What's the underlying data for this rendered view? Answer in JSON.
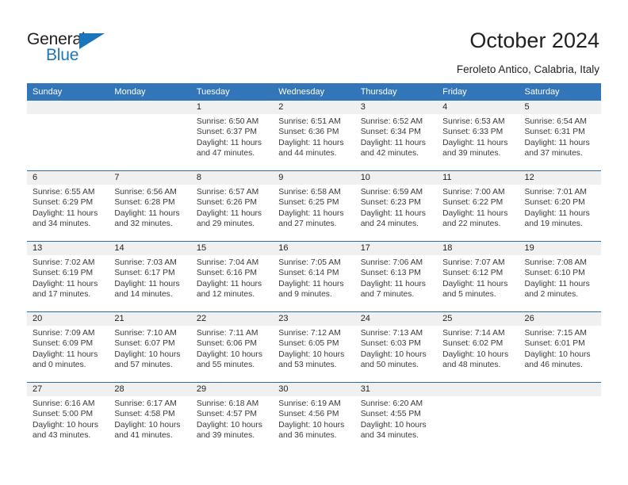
{
  "brand": {
    "name_part1": "General",
    "name_part2": "Blue",
    "triangle_icon": "blue-triangle-icon",
    "accent_color": "#1b75bb"
  },
  "header": {
    "title": "October 2024",
    "subtitle": "Feroleto Antico, Calabria, Italy"
  },
  "theme": {
    "header_blue": "#3275b8",
    "row_divider_blue": "#2e6da4",
    "date_band_gray": "#f0f0f0"
  },
  "calendar": {
    "weekday_headers": [
      "Sunday",
      "Monday",
      "Tuesday",
      "Wednesday",
      "Thursday",
      "Friday",
      "Saturday"
    ],
    "labels": {
      "sunrise": "Sunrise:",
      "sunset": "Sunset:",
      "daylight": "Daylight:"
    },
    "weeks": [
      [
        {
          "day": "",
          "sunrise": "",
          "sunset": "",
          "daylight_line1": "",
          "daylight_line2": ""
        },
        {
          "day": "",
          "sunrise": "",
          "sunset": "",
          "daylight_line1": "",
          "daylight_line2": ""
        },
        {
          "day": "1",
          "sunrise": "Sunrise: 6:50 AM",
          "sunset": "Sunset: 6:37 PM",
          "daylight_line1": "Daylight: 11 hours",
          "daylight_line2": "and 47 minutes."
        },
        {
          "day": "2",
          "sunrise": "Sunrise: 6:51 AM",
          "sunset": "Sunset: 6:36 PM",
          "daylight_line1": "Daylight: 11 hours",
          "daylight_line2": "and 44 minutes."
        },
        {
          "day": "3",
          "sunrise": "Sunrise: 6:52 AM",
          "sunset": "Sunset: 6:34 PM",
          "daylight_line1": "Daylight: 11 hours",
          "daylight_line2": "and 42 minutes."
        },
        {
          "day": "4",
          "sunrise": "Sunrise: 6:53 AM",
          "sunset": "Sunset: 6:33 PM",
          "daylight_line1": "Daylight: 11 hours",
          "daylight_line2": "and 39 minutes."
        },
        {
          "day": "5",
          "sunrise": "Sunrise: 6:54 AM",
          "sunset": "Sunset: 6:31 PM",
          "daylight_line1": "Daylight: 11 hours",
          "daylight_line2": "and 37 minutes."
        }
      ],
      [
        {
          "day": "6",
          "sunrise": "Sunrise: 6:55 AM",
          "sunset": "Sunset: 6:29 PM",
          "daylight_line1": "Daylight: 11 hours",
          "daylight_line2": "and 34 minutes."
        },
        {
          "day": "7",
          "sunrise": "Sunrise: 6:56 AM",
          "sunset": "Sunset: 6:28 PM",
          "daylight_line1": "Daylight: 11 hours",
          "daylight_line2": "and 32 minutes."
        },
        {
          "day": "8",
          "sunrise": "Sunrise: 6:57 AM",
          "sunset": "Sunset: 6:26 PM",
          "daylight_line1": "Daylight: 11 hours",
          "daylight_line2": "and 29 minutes."
        },
        {
          "day": "9",
          "sunrise": "Sunrise: 6:58 AM",
          "sunset": "Sunset: 6:25 PM",
          "daylight_line1": "Daylight: 11 hours",
          "daylight_line2": "and 27 minutes."
        },
        {
          "day": "10",
          "sunrise": "Sunrise: 6:59 AM",
          "sunset": "Sunset: 6:23 PM",
          "daylight_line1": "Daylight: 11 hours",
          "daylight_line2": "and 24 minutes."
        },
        {
          "day": "11",
          "sunrise": "Sunrise: 7:00 AM",
          "sunset": "Sunset: 6:22 PM",
          "daylight_line1": "Daylight: 11 hours",
          "daylight_line2": "and 22 minutes."
        },
        {
          "day": "12",
          "sunrise": "Sunrise: 7:01 AM",
          "sunset": "Sunset: 6:20 PM",
          "daylight_line1": "Daylight: 11 hours",
          "daylight_line2": "and 19 minutes."
        }
      ],
      [
        {
          "day": "13",
          "sunrise": "Sunrise: 7:02 AM",
          "sunset": "Sunset: 6:19 PM",
          "daylight_line1": "Daylight: 11 hours",
          "daylight_line2": "and 17 minutes."
        },
        {
          "day": "14",
          "sunrise": "Sunrise: 7:03 AM",
          "sunset": "Sunset: 6:17 PM",
          "daylight_line1": "Daylight: 11 hours",
          "daylight_line2": "and 14 minutes."
        },
        {
          "day": "15",
          "sunrise": "Sunrise: 7:04 AM",
          "sunset": "Sunset: 6:16 PM",
          "daylight_line1": "Daylight: 11 hours",
          "daylight_line2": "and 12 minutes."
        },
        {
          "day": "16",
          "sunrise": "Sunrise: 7:05 AM",
          "sunset": "Sunset: 6:14 PM",
          "daylight_line1": "Daylight: 11 hours",
          "daylight_line2": "and 9 minutes."
        },
        {
          "day": "17",
          "sunrise": "Sunrise: 7:06 AM",
          "sunset": "Sunset: 6:13 PM",
          "daylight_line1": "Daylight: 11 hours",
          "daylight_line2": "and 7 minutes."
        },
        {
          "day": "18",
          "sunrise": "Sunrise: 7:07 AM",
          "sunset": "Sunset: 6:12 PM",
          "daylight_line1": "Daylight: 11 hours",
          "daylight_line2": "and 5 minutes."
        },
        {
          "day": "19",
          "sunrise": "Sunrise: 7:08 AM",
          "sunset": "Sunset: 6:10 PM",
          "daylight_line1": "Daylight: 11 hours",
          "daylight_line2": "and 2 minutes."
        }
      ],
      [
        {
          "day": "20",
          "sunrise": "Sunrise: 7:09 AM",
          "sunset": "Sunset: 6:09 PM",
          "daylight_line1": "Daylight: 11 hours",
          "daylight_line2": "and 0 minutes."
        },
        {
          "day": "21",
          "sunrise": "Sunrise: 7:10 AM",
          "sunset": "Sunset: 6:07 PM",
          "daylight_line1": "Daylight: 10 hours",
          "daylight_line2": "and 57 minutes."
        },
        {
          "day": "22",
          "sunrise": "Sunrise: 7:11 AM",
          "sunset": "Sunset: 6:06 PM",
          "daylight_line1": "Daylight: 10 hours",
          "daylight_line2": "and 55 minutes."
        },
        {
          "day": "23",
          "sunrise": "Sunrise: 7:12 AM",
          "sunset": "Sunset: 6:05 PM",
          "daylight_line1": "Daylight: 10 hours",
          "daylight_line2": "and 53 minutes."
        },
        {
          "day": "24",
          "sunrise": "Sunrise: 7:13 AM",
          "sunset": "Sunset: 6:03 PM",
          "daylight_line1": "Daylight: 10 hours",
          "daylight_line2": "and 50 minutes."
        },
        {
          "day": "25",
          "sunrise": "Sunrise: 7:14 AM",
          "sunset": "Sunset: 6:02 PM",
          "daylight_line1": "Daylight: 10 hours",
          "daylight_line2": "and 48 minutes."
        },
        {
          "day": "26",
          "sunrise": "Sunrise: 7:15 AM",
          "sunset": "Sunset: 6:01 PM",
          "daylight_line1": "Daylight: 10 hours",
          "daylight_line2": "and 46 minutes."
        }
      ],
      [
        {
          "day": "27",
          "sunrise": "Sunrise: 6:16 AM",
          "sunset": "Sunset: 5:00 PM",
          "daylight_line1": "Daylight: 10 hours",
          "daylight_line2": "and 43 minutes."
        },
        {
          "day": "28",
          "sunrise": "Sunrise: 6:17 AM",
          "sunset": "Sunset: 4:58 PM",
          "daylight_line1": "Daylight: 10 hours",
          "daylight_line2": "and 41 minutes."
        },
        {
          "day": "29",
          "sunrise": "Sunrise: 6:18 AM",
          "sunset": "Sunset: 4:57 PM",
          "daylight_line1": "Daylight: 10 hours",
          "daylight_line2": "and 39 minutes."
        },
        {
          "day": "30",
          "sunrise": "Sunrise: 6:19 AM",
          "sunset": "Sunset: 4:56 PM",
          "daylight_line1": "Daylight: 10 hours",
          "daylight_line2": "and 36 minutes."
        },
        {
          "day": "31",
          "sunrise": "Sunrise: 6:20 AM",
          "sunset": "Sunset: 4:55 PM",
          "daylight_line1": "Daylight: 10 hours",
          "daylight_line2": "and 34 minutes."
        },
        {
          "day": "",
          "sunrise": "",
          "sunset": "",
          "daylight_line1": "",
          "daylight_line2": ""
        },
        {
          "day": "",
          "sunrise": "",
          "sunset": "",
          "daylight_line1": "",
          "daylight_line2": ""
        }
      ]
    ]
  }
}
